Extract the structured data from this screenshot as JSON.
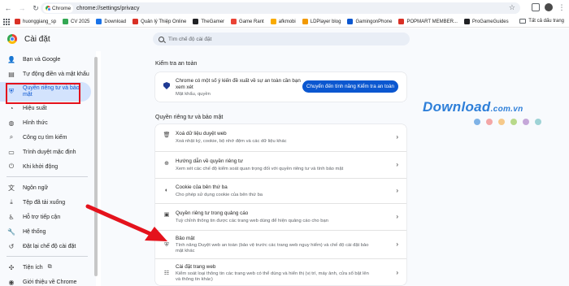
{
  "browser": {
    "tab_chip": "Chrome",
    "url": "chrome://settings/privacy"
  },
  "bookmarks": [
    {
      "label": "huonggiang_sp",
      "color": "#d93025"
    },
    {
      "label": "CV 2025",
      "color": "#34a853"
    },
    {
      "label": "Download",
      "color": "#1a73e8"
    },
    {
      "label": "Quản lý Thiệp Online",
      "color": "#d93025"
    },
    {
      "label": "TheGamer",
      "color": "#202124"
    },
    {
      "label": "Game Rant",
      "color": "#ea4335"
    },
    {
      "label": "afkmobi",
      "color": "#f9ab00"
    },
    {
      "label": "LDPlayer blog",
      "color": "#f29900"
    },
    {
      "label": "GamingonPhone",
      "color": "#0b57d0"
    },
    {
      "label": "POPMART MEMBER...",
      "color": "#d93025"
    },
    {
      "label": "ProGameGuides",
      "color": "#202124"
    }
  ],
  "bookmarks_folder": "Tất cả dấu trang",
  "settings": {
    "title": "Cài đặt",
    "search_placeholder": "Tìm chế độ cài đặt"
  },
  "sidebar": {
    "items": [
      {
        "label": "Bạn và Google",
        "icon": "person-icon"
      },
      {
        "label": "Tự động điền và mật khẩu",
        "icon": "clipboard-icon"
      },
      {
        "label": "Quyền riêng tư và bảo mật",
        "icon": "shield-icon"
      },
      {
        "label": "Hiệu suất",
        "icon": "speedometer-icon"
      },
      {
        "label": "Hình thức",
        "icon": "palette-icon"
      },
      {
        "label": "Công cụ tìm kiếm",
        "icon": "search-icon"
      },
      {
        "label": "Trình duyệt mặc định",
        "icon": "browser-icon"
      },
      {
        "label": "Khi khởi động",
        "icon": "power-icon"
      },
      {
        "label": "Ngôn ngữ",
        "icon": "translate-icon"
      },
      {
        "label": "Tệp đã tải xuống",
        "icon": "download-icon"
      },
      {
        "label": "Hỗ trợ tiếp cận",
        "icon": "accessibility-icon"
      },
      {
        "label": "Hệ thống",
        "icon": "wrench-icon"
      },
      {
        "label": "Đặt lại chế độ cài đặt",
        "icon": "reset-icon"
      },
      {
        "label": "Tiện ích",
        "icon": "puzzle-icon"
      },
      {
        "label": "Giới thiệu về Chrome",
        "icon": "chrome-icon"
      }
    ]
  },
  "safety_check": {
    "heading": "Kiểm tra an toàn",
    "text": "Chrome có một số ý kiến đề xuất về sự an toàn cần bạn xem xét",
    "sub": "Mật khẩu, quyền",
    "button": "Chuyển đến tính năng Kiểm tra an toàn"
  },
  "privacy": {
    "heading": "Quyền riêng tư và bảo mật",
    "rows": [
      {
        "title": "Xoá dữ liệu duyệt web",
        "sub": "Xoá nhật ký, cookie, bộ nhớ đệm và các dữ liệu khác"
      },
      {
        "title": "Hướng dẫn về quyền riêng tư",
        "sub": "Xem xét các chế độ kiểm soát quan trọng đối với quyền riêng tư và tính bảo mật"
      },
      {
        "title": "Cookie của bên thứ ba",
        "sub": "Cho phép sử dụng cookie của bên thứ ba"
      },
      {
        "title": "Quyền riêng tư trong quảng cáo",
        "sub": "Tuỳ chỉnh thông tin được các trang web dùng để hiện quảng cáo cho bạn"
      },
      {
        "title": "Bảo mật",
        "sub": "Tính năng Duyệt web an toàn (bảo vệ trước các trang web nguy hiểm) và chế độ cài đặt bảo mật khác"
      },
      {
        "title": "Cài đặt trang web",
        "sub": "Kiểm soát loại thông tin các trang web có thể dùng và hiển thị (vị trí, máy ảnh, cửa sổ bật lên và thông tin khác)"
      }
    ]
  },
  "watermark": {
    "brand": "Download",
    "domain": ".com.vn",
    "dot_colors": [
      "#7fb2e6",
      "#f3a6a6",
      "#f6c98a",
      "#b8d98a",
      "#c5a7d9",
      "#9ed3d6"
    ]
  }
}
